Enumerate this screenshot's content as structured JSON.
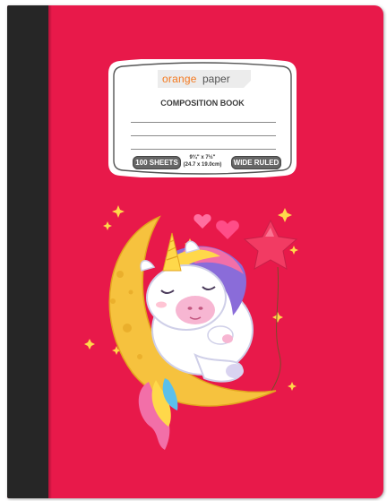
{
  "cover": {
    "brand": {
      "part1": "orange",
      "part2": "paper"
    },
    "title": "COMPOSITION BOOK",
    "sheets": "100 SHEETS",
    "size_imperial": "9¾\" x 7½\"",
    "size_metric": "(24.7 x 19.0cm)",
    "ruling": "WIDE RULED"
  },
  "colors": {
    "cover": "#e8194a",
    "spine": "#262626",
    "brand_orange": "#f47a20",
    "moon": "#f6c23e",
    "star": "#ffd84a",
    "balloon": "#f23b63"
  },
  "illustration": "unicorn-sleeping-on-moon-with-star-balloon"
}
